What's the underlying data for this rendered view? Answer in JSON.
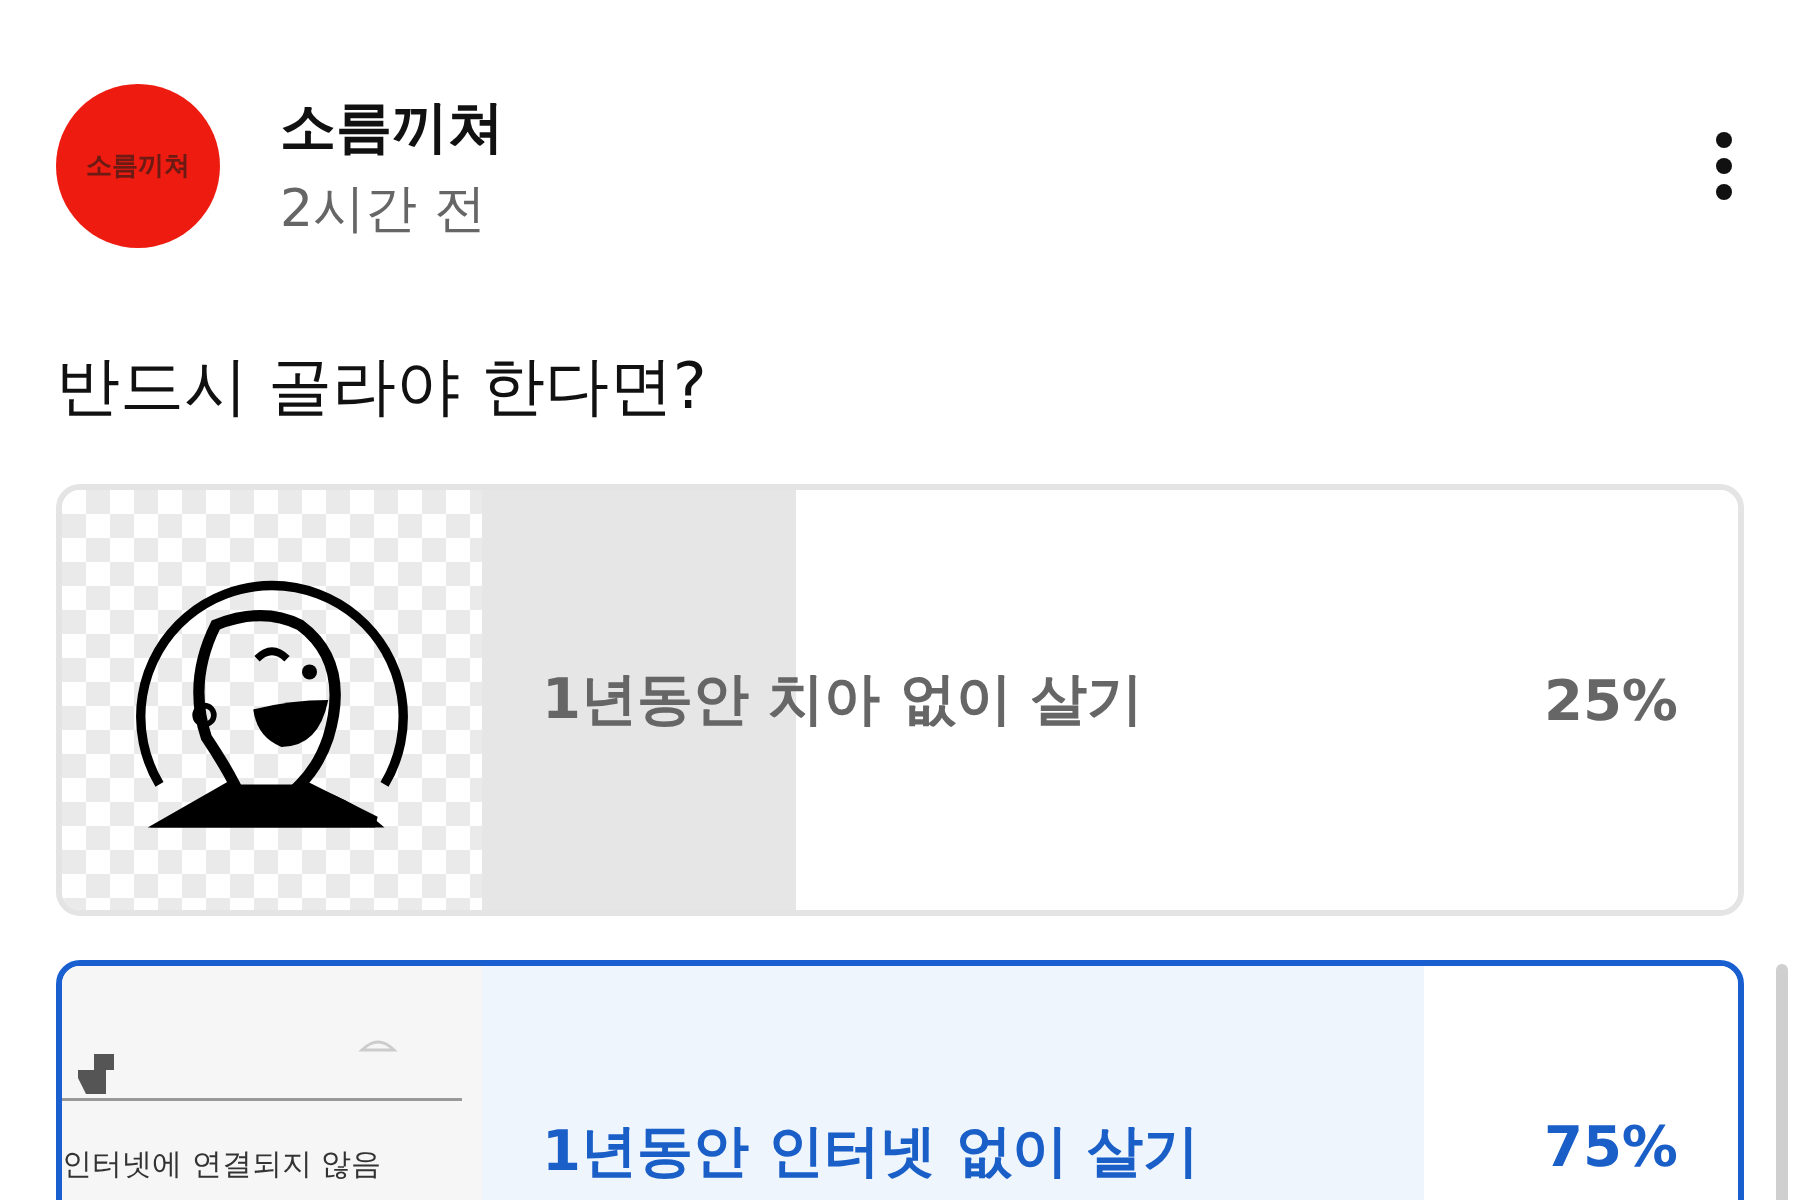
{
  "post": {
    "author": "소름끼쳐",
    "avatar_text": "소름끼쳐",
    "time": "2시간 전"
  },
  "poll": {
    "question": "반드시 골라야 한다면?",
    "options": [
      {
        "kind": "face",
        "label": "1년동안 치아 없이 살기",
        "percent": "25%",
        "level": 0.25,
        "selected": false
      },
      {
        "kind": "offline",
        "label": "1년동안 인터넷 없이 살기",
        "percent": "75%",
        "level": 0.75,
        "selected": true,
        "image_text": "인터넷에 연결되지 않음"
      }
    ]
  }
}
